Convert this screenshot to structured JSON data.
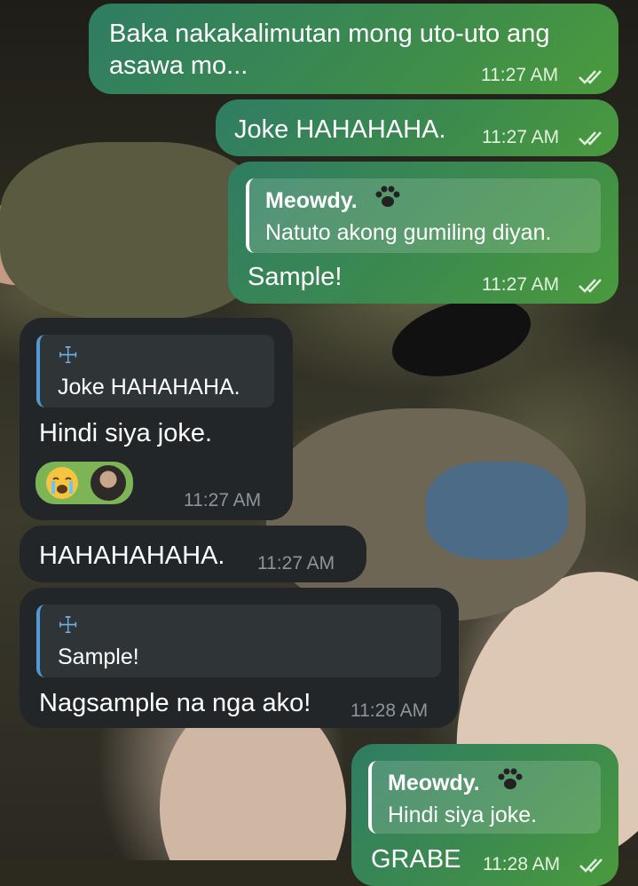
{
  "messages": [
    {
      "text": "Baka nakakalimutan mong uto-uto ang asawa mo...",
      "time": "11:27 AM",
      "direction": "outgoing",
      "status": "read"
    },
    {
      "text": "Joke HAHAHAHA.",
      "time": "11:27 AM",
      "direction": "outgoing",
      "status": "read"
    },
    {
      "reply_to": {
        "name": "Meowdy.",
        "text": "Natuto akong gumiling diyan."
      },
      "text": "Sample!",
      "time": "11:27 AM",
      "direction": "outgoing",
      "status": "read"
    },
    {
      "reply_to": {
        "name": "☩",
        "text": "Joke HAHAHAHA."
      },
      "text": "Hindi siya joke.",
      "time": "11:27 AM",
      "direction": "incoming",
      "reactions": [
        "crying-emoji",
        "reactor-avatar"
      ]
    },
    {
      "text": "HAHAHAHAHA.",
      "time": "11:27 AM",
      "direction": "incoming"
    },
    {
      "reply_to": {
        "name": "☩",
        "text": "Sample!"
      },
      "text": "Nagsample na nga ako!",
      "time": "11:28 AM",
      "direction": "incoming"
    },
    {
      "reply_to": {
        "name": "Meowdy.",
        "text": "Hindi siya joke."
      },
      "text": "GRABE",
      "time": "11:28 AM",
      "direction": "outgoing",
      "status": "read"
    }
  ],
  "colors": {
    "outgoing_bubble": "#3c8a4e",
    "incoming_bubble": "#232628",
    "reply_accent_incoming": "#4e9bd6",
    "reaction_bg": "#7db456"
  }
}
